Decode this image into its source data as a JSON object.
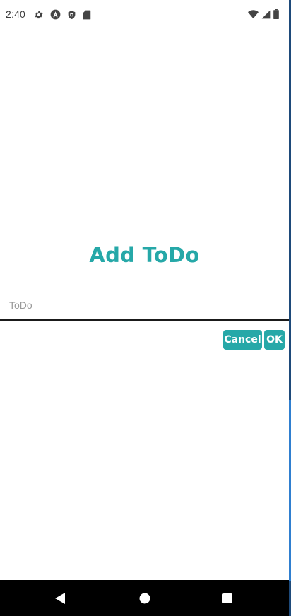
{
  "status_bar": {
    "time": "2:40",
    "left_icons": [
      "gear-icon",
      "android-a-icon",
      "shield-icon",
      "sd-card-icon"
    ],
    "right_icons": [
      "wifi-icon",
      "signal-icon",
      "battery-icon"
    ]
  },
  "dialog": {
    "title": "Add ToDo",
    "input_placeholder": "ToDo",
    "input_value": "",
    "cancel_label": "Cancel",
    "ok_label": "OK"
  },
  "nav_bar": {
    "buttons": [
      "back-icon",
      "home-icon",
      "recents-icon"
    ]
  },
  "colors": {
    "accent": "#26a8a8",
    "nav_background": "#000000",
    "background": "#ffffff"
  }
}
